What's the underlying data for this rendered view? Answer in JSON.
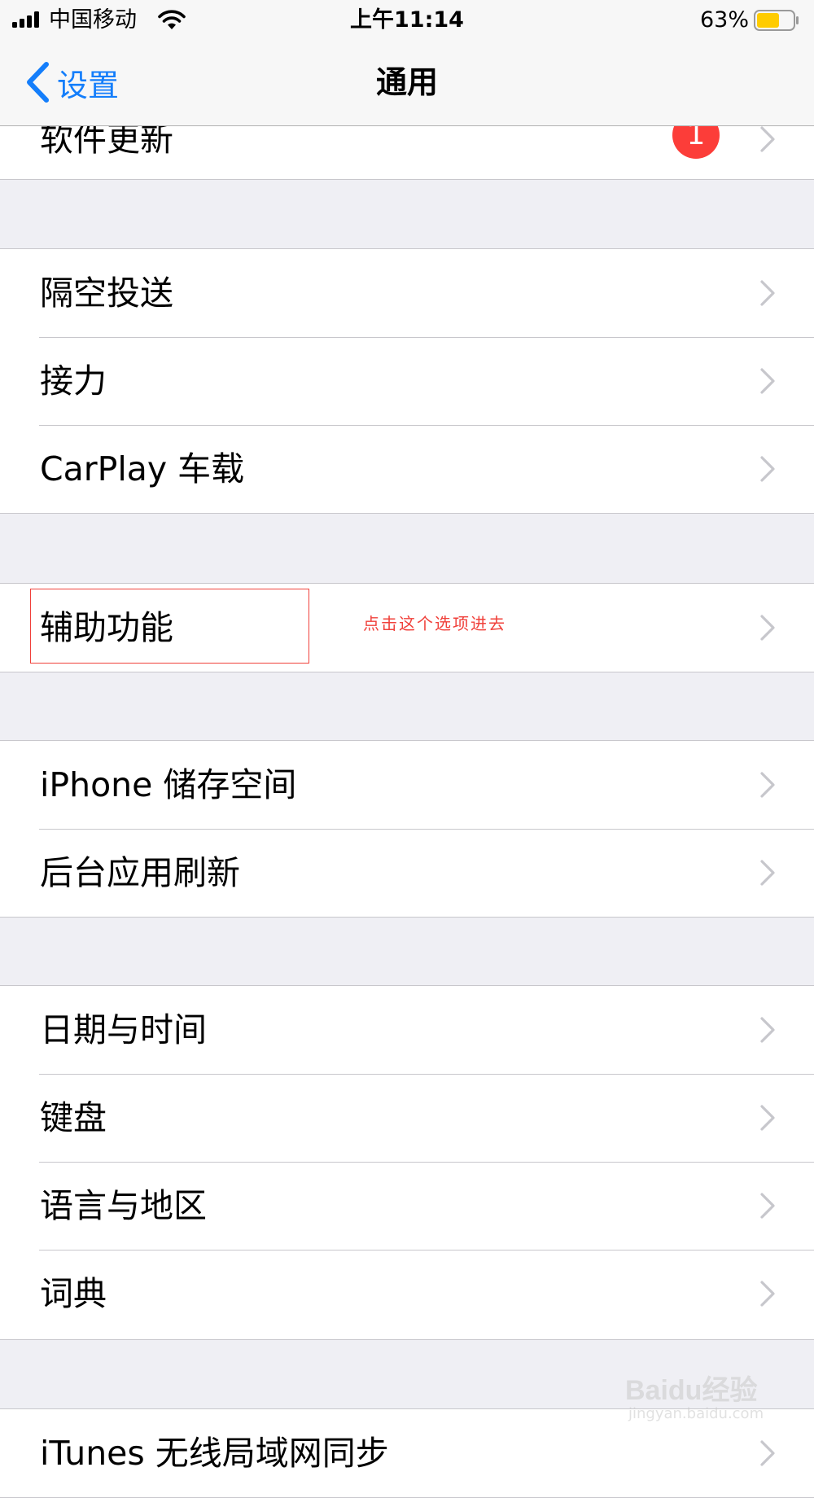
{
  "status_bar": {
    "carrier": "中国移动",
    "time": "上午11:14",
    "battery_percent": "63%",
    "battery_level": 0.63,
    "battery_color": "#ffcc00"
  },
  "nav": {
    "back_label": "设置",
    "title": "通用",
    "accent_color": "#147efb"
  },
  "groups": [
    {
      "rows": [
        {
          "label": "软件更新",
          "badge": "1"
        }
      ]
    },
    {
      "rows": [
        {
          "label": "隔空投送"
        },
        {
          "label": "接力"
        },
        {
          "label": "CarPlay 车载"
        }
      ]
    },
    {
      "rows": [
        {
          "label": "辅助功能"
        }
      ]
    },
    {
      "rows": [
        {
          "label": "iPhone 储存空间"
        },
        {
          "label": "后台应用刷新"
        }
      ]
    },
    {
      "rows": [
        {
          "label": "日期与时间"
        },
        {
          "label": "键盘"
        },
        {
          "label": "语言与地区"
        },
        {
          "label": "词典"
        }
      ]
    },
    {
      "rows": [
        {
          "label": "iTunes 无线局域网同步"
        }
      ]
    }
  ],
  "annotation": {
    "text": "点击这个选项进去",
    "color": "#f0413b"
  },
  "watermark": {
    "logo": "Baidu经验",
    "url": "jingyan.baidu.com"
  },
  "icons": {
    "chevron": "chevron-right-icon",
    "back": "chevron-left-icon",
    "signal": "cellular-signal-icon",
    "wifi": "wifi-icon",
    "battery": "battery-icon"
  }
}
